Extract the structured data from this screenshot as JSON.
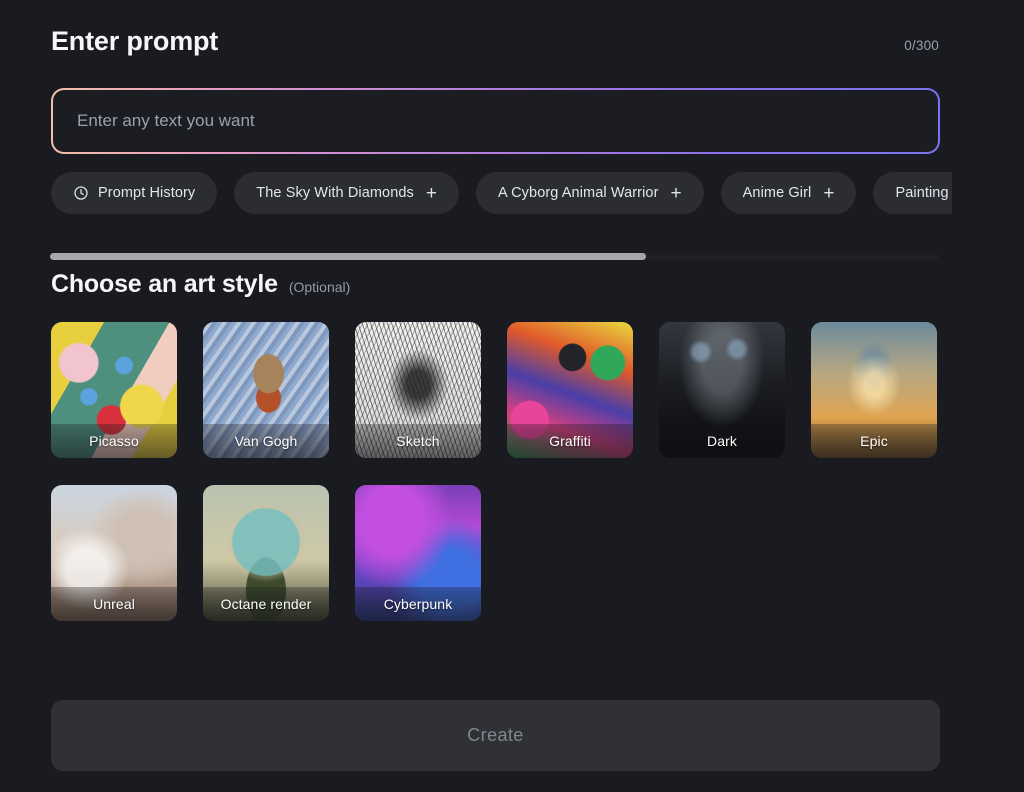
{
  "header": {
    "title": "Enter prompt",
    "char_counter": "0/300"
  },
  "prompt": {
    "value": "",
    "placeholder": "Enter any text you want"
  },
  "chips": [
    {
      "label": "Prompt History",
      "icon": "clock-icon",
      "plus": ""
    },
    {
      "label": "The Sky With Diamonds",
      "icon": "",
      "plus": "+"
    },
    {
      "label": "A Cyborg Animal Warrior",
      "icon": "",
      "plus": "+"
    },
    {
      "label": "Anime Girl",
      "icon": "",
      "plus": "+"
    },
    {
      "label": "Painting",
      "icon": "",
      "plus": "+"
    }
  ],
  "scrollbar": {
    "thumb_percent": "67%"
  },
  "art_style": {
    "title": "Choose an art style",
    "optional": "(Optional)",
    "tiles": [
      {
        "label": "Picasso"
      },
      {
        "label": "Van Gogh"
      },
      {
        "label": "Sketch"
      },
      {
        "label": "Graffiti"
      },
      {
        "label": "Dark"
      },
      {
        "label": "Epic"
      },
      {
        "label": "Unreal"
      },
      {
        "label": "Octane render"
      },
      {
        "label": "Cyberpunk"
      }
    ]
  },
  "footer": {
    "create_label": "Create"
  },
  "colors": {
    "background": "#1a1b20",
    "chip_bg": "#2b2d33",
    "create_bg": "#303137",
    "gradient_start": "#f2c0a8",
    "gradient_end": "#7b73f0",
    "scroll_thumb": "#a6a8ab"
  }
}
